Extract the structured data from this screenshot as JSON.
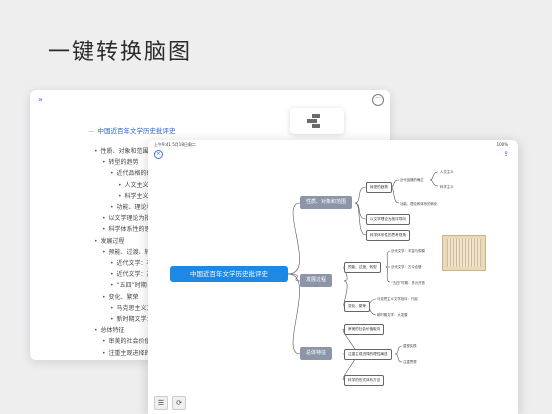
{
  "headline": "一键转换脑图",
  "outline": {
    "title": "中国近百年文学历史批评史",
    "items": [
      {
        "text": "性质、对象和范围",
        "level": 0
      },
      {
        "text": "转型的趋势",
        "level": 1
      },
      {
        "text": "近代品格的确",
        "level": 2
      },
      {
        "text": "人文主义",
        "level": 3
      },
      {
        "text": "科学主义",
        "level": 3
      },
      {
        "text": "功能、理论和",
        "level": 2
      },
      {
        "text": "以文学理论为批",
        "level": 1
      },
      {
        "text": "科学体系性的思",
        "level": 1
      },
      {
        "text": "发展过程",
        "level": 0
      },
      {
        "text": "预能、过渡、转",
        "level": 1
      },
      {
        "text": "近代文学：丰",
        "level": 2
      },
      {
        "text": "近代文学：古",
        "level": 2
      },
      {
        "text": "“五四”时期",
        "level": 2
      },
      {
        "text": "变化、繁荣",
        "level": 1
      },
      {
        "text": "马克思主义文",
        "level": 2
      },
      {
        "text": "新时期文学：",
        "level": 2
      },
      {
        "text": "总体特征",
        "level": 0
      },
      {
        "text": "审美的社会价值",
        "level": 1
      },
      {
        "text": "注重主观进择的",
        "level": 1
      }
    ]
  },
  "mindmap": {
    "status_time": "上午9:41  5月18日周二",
    "status_battery": "100%",
    "root": "中国近百年文学历史批评史",
    "branches": [
      {
        "label": "性质、对象和范围",
        "children": [
          {
            "label": "转型的趋势",
            "leaves": [
              "近代品格的确立",
              "功能、理论和体系的转化"
            ],
            "subleaves": [
              "人文主义",
              "科学主义"
            ]
          },
          {
            "label": "以文学理论为批评导向"
          },
          {
            "label": "科学体系性的思考视角"
          }
        ]
      },
      {
        "label": "发展过程",
        "children": [
          {
            "label": "预能、过渡、转型",
            "leaves": [
              "近代文学：丰富与规模",
              "近代文学：古今合璧",
              "“五四”时期：多元开放"
            ]
          },
          {
            "label": "变化、繁荣",
            "leaves": [
              "马克思主义文学批评：兴起",
              "新时期文学：大发展"
            ]
          }
        ]
      },
      {
        "label": "总体特征",
        "children": [
          {
            "label": "审美的社会价值取向"
          },
          {
            "label": "注重主观进择的理性阐述",
            "leaves": [
              "重视实践",
              "注重思想"
            ]
          },
          {
            "label": "科学的形式体系方法"
          }
        ]
      }
    ]
  },
  "icons": {
    "expand": "»",
    "more": "···",
    "close": "✕",
    "share": "⇪",
    "outline_view": "☰",
    "convert": "⟳"
  }
}
